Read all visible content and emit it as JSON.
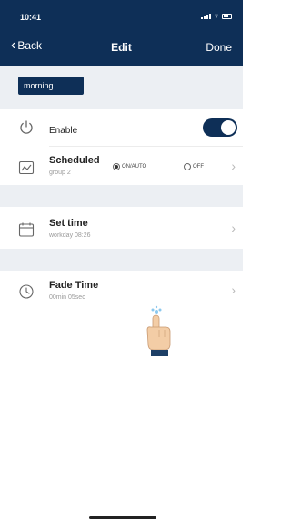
{
  "status": {
    "time": "10:41"
  },
  "nav": {
    "back_label": "Back",
    "title": "Edit",
    "done_label": "Done"
  },
  "name_field": {
    "value": "morning"
  },
  "rows": {
    "enable": {
      "label": "Enable",
      "on": true
    },
    "scheduled": {
      "title": "Scheduled",
      "subtitle": "group 2",
      "option_on": "ON/AUTO",
      "option_off": "OFF",
      "selected": "ON/AUTO"
    },
    "set_time": {
      "title": "Set time",
      "subtitle": "workday 08:26"
    },
    "fade_time": {
      "title": "Fade Time",
      "subtitle": "00min 05sec"
    }
  },
  "colors": {
    "header": "#0e2f57",
    "accent": "#0e2f57",
    "band": "#eceff3"
  },
  "icons": [
    "back-chevron-icon",
    "power-icon",
    "schedule-icon",
    "calendar-icon",
    "clock-icon",
    "chevron-right-icon",
    "tap-hand-icon"
  ]
}
